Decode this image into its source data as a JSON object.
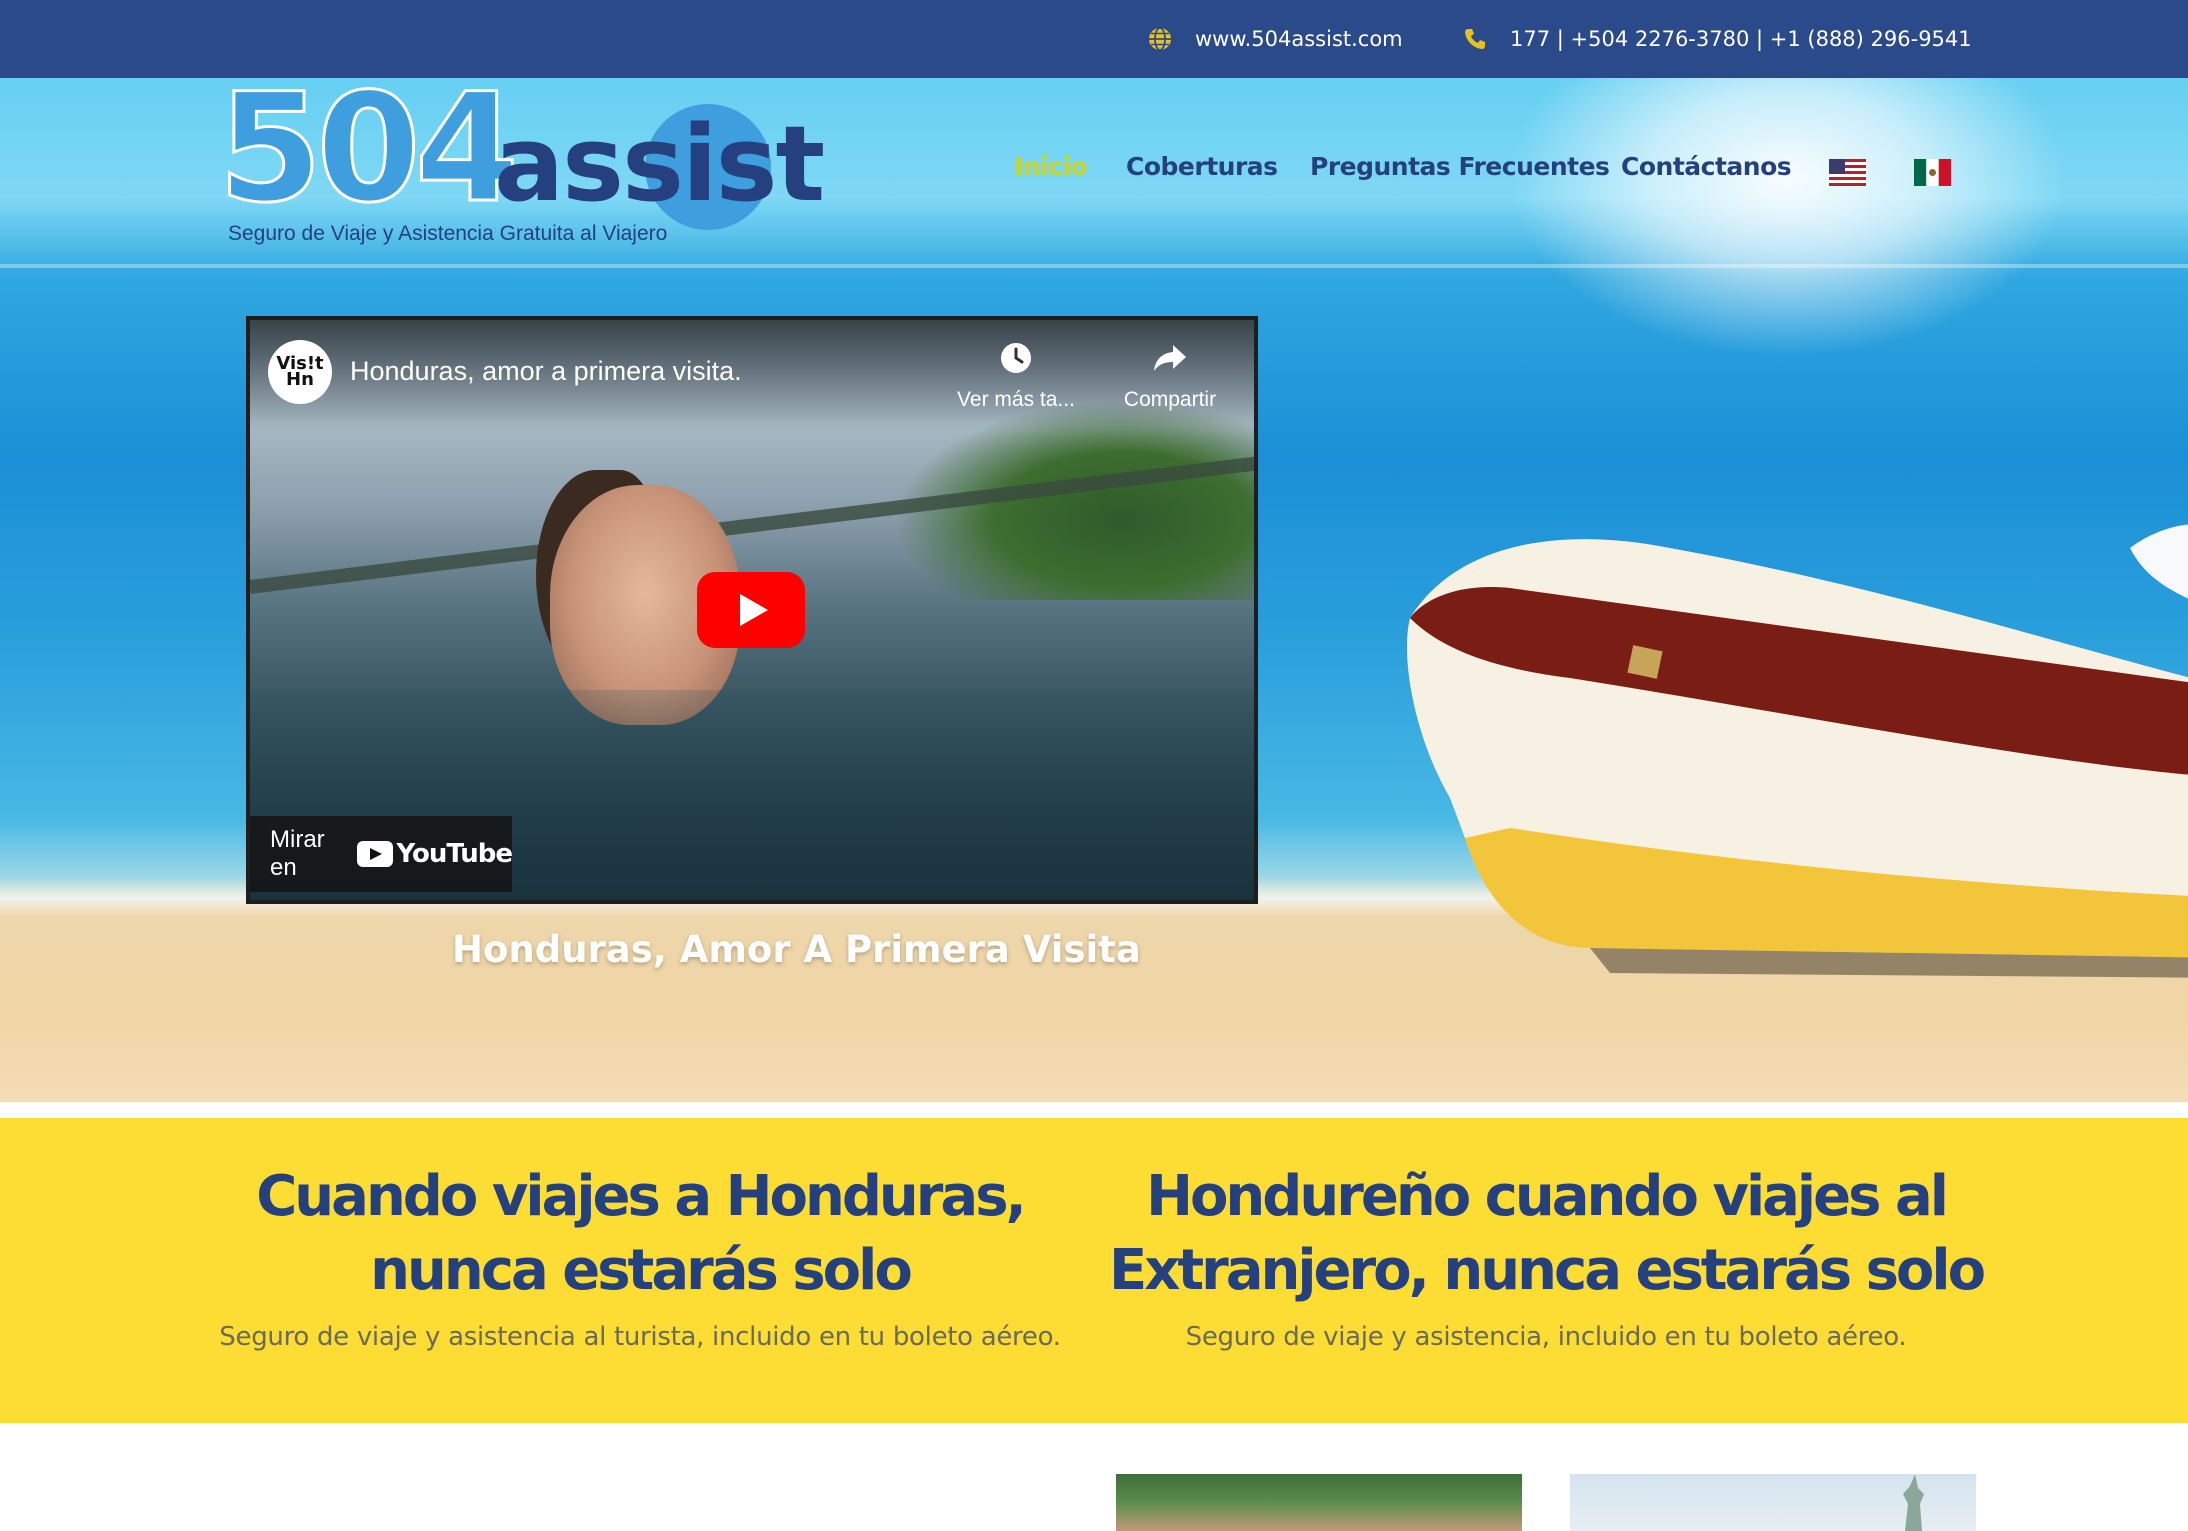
{
  "topbar": {
    "website": "www.504assist.com",
    "phones": "177  |  +504 2276-3780 | +1 (888) 296-9541",
    "globe_icon": "globe-icon",
    "phone_icon": "phone-icon",
    "background": "#2b4a8a"
  },
  "logo": {
    "number": "504",
    "word": "assist",
    "tagline": "Seguro de Viaje y Asistencia Gratuita al Viajero"
  },
  "nav": {
    "items": [
      {
        "label": "Inicio",
        "active": true
      },
      {
        "label": "Coberturas",
        "active": false
      },
      {
        "label": "Preguntas Frecuentes",
        "active": false
      },
      {
        "label": "Contáctanos",
        "active": false
      }
    ],
    "flags": [
      "us-flag-icon",
      "mexico-flag-icon"
    ],
    "active_color": "#c8d42c",
    "color": "#24407e"
  },
  "video": {
    "channel_avatar": "Vis!t Hn",
    "title": "Honduras, amor a primera visita.",
    "watch_later": "Ver más ta...",
    "share": "Compartir",
    "watch_on": "Mirar en",
    "youtube": "YouTube"
  },
  "hero": {
    "caption": "Honduras, Amor A Primera Visita"
  },
  "band": {
    "background": "#fddc33",
    "left": {
      "heading_line1": "Cuando viajes a Honduras,",
      "heading_line2": "nunca estarás solo",
      "subtitle": "Seguro de viaje y asistencia al turista, incluido en tu boleto aéreo."
    },
    "right": {
      "heading_line1": "Hondureño cuando viajes al",
      "heading_line2": "Extranjero, nunca estarás solo",
      "subtitle": "Seguro de viaje y asistencia, incluido en tu boleto aéreo."
    }
  }
}
